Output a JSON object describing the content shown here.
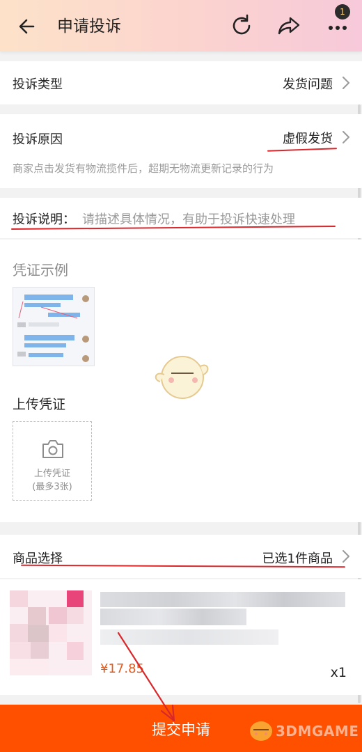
{
  "header": {
    "title": "申请投诉",
    "badge_count": "1",
    "icons": [
      "back-arrow-icon",
      "refresh-icon",
      "share-icon",
      "more-icon"
    ]
  },
  "complaint_type": {
    "label": "投诉类型",
    "value": "发货问题"
  },
  "complaint_reason": {
    "label": "投诉原因",
    "value": "虚假发货",
    "hint": "商家点击发货有物流揽件后，超期无物流更新记录的行为"
  },
  "complaint_desc": {
    "label": "投诉说明：",
    "placeholder": "请描述具体情况，有助于投诉快速处理"
  },
  "evidence": {
    "example_title": "凭证示例",
    "upload_title": "上传凭证",
    "upload_line1": "上传凭证",
    "upload_line2": "(最多3张)"
  },
  "product": {
    "label": "商品选择",
    "value": "已选1件商品",
    "price": "¥17.85",
    "qty": "x1"
  },
  "submit": {
    "label": "提交申请"
  },
  "watermark": {
    "text": "3DMGAME"
  },
  "colors": {
    "accent": "#ff5000",
    "annotation": "#d8282c",
    "price": "#e35b1e"
  }
}
